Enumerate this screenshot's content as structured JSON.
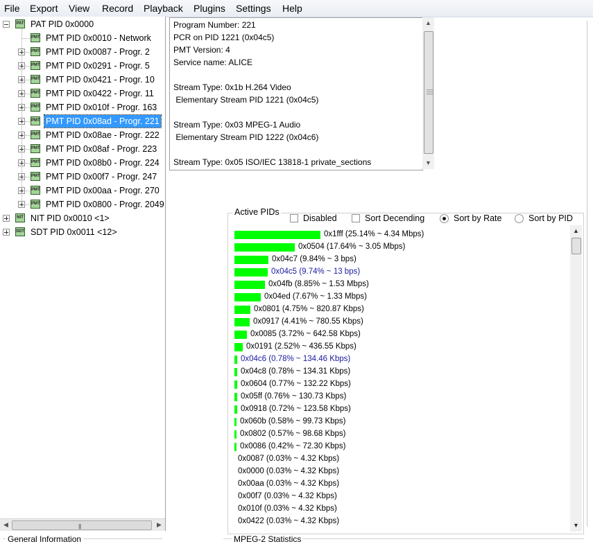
{
  "menu": [
    "File",
    "Export",
    "View",
    "Record",
    "Playback",
    "Plugins",
    "Settings",
    "Help"
  ],
  "tree": {
    "root": {
      "label": "PAT PID 0x0000",
      "icon": "PAT"
    },
    "children": [
      {
        "label": "PMT PID 0x0010 - Network",
        "icon": "PMT",
        "expander": false
      },
      {
        "label": "PMT PID 0x0087 - Progr. 2",
        "icon": "PMT",
        "expander": true
      },
      {
        "label": "PMT PID 0x0291 - Progr. 5",
        "icon": "PMT",
        "expander": true
      },
      {
        "label": "PMT PID 0x0421 - Progr. 10",
        "icon": "PMT",
        "expander": true
      },
      {
        "label": "PMT PID 0x0422 - Progr. 11",
        "icon": "PMT",
        "expander": true
      },
      {
        "label": "PMT PID 0x010f - Progr. 163",
        "icon": "PMT",
        "expander": true
      },
      {
        "label": "PMT PID 0x08ad - Progr. 221",
        "icon": "PMT",
        "expander": true,
        "selected": true
      },
      {
        "label": "PMT PID 0x08ae - Progr. 222",
        "icon": "PMT",
        "expander": true
      },
      {
        "label": "PMT PID 0x08af - Progr. 223",
        "icon": "PMT",
        "expander": true
      },
      {
        "label": "PMT PID 0x08b0 - Progr. 224",
        "icon": "PMT",
        "expander": true
      },
      {
        "label": "PMT PID 0x00f7 - Progr. 247",
        "icon": "PMT",
        "expander": true
      },
      {
        "label": "PMT PID 0x00aa - Progr. 270",
        "icon": "PMT",
        "expander": true
      },
      {
        "label": "PMT PID 0x0800 - Progr. 2049",
        "icon": "PMT",
        "expander": true
      }
    ],
    "others": [
      {
        "label": "NIT PID 0x0010 <1>",
        "icon": "NIT"
      },
      {
        "label": "SDT PID 0x0011 <12>",
        "icon": "SDT"
      }
    ]
  },
  "info": [
    "Program Number: 221",
    "PCR on PID 1221 (0x04c5)",
    "PMT Version: 4",
    "Service name: ALICE",
    "",
    "Stream Type: 0x1b H.264 Video",
    " Elementary Stream PID 1221 (0x04c5)",
    "",
    "Stream Type: 0x03 MPEG-1 Audio",
    " Elementary Stream PID 1222 (0x04c6)",
    "",
    "Stream Type: 0x05 ISO/IEC 13818-1 private_sections"
  ],
  "active_pids": {
    "title": "Active PIDs",
    "options": {
      "disabled": {
        "label": "Disabled",
        "checked": false
      },
      "sort_desc": {
        "label": "Sort Decending",
        "checked": false
      },
      "sort_rate": {
        "label": "Sort by Rate",
        "selected": true
      },
      "sort_pid": {
        "label": "Sort by PID",
        "selected": false
      }
    },
    "rows": [
      {
        "text": "0x1fff (25.14% ~ 4.34 Mbps)",
        "pct": 25.14
      },
      {
        "text": "0x0504 (17.64% ~ 3.05 Mbps)",
        "pct": 17.64
      },
      {
        "text": "0x04c7 (9.84% ~ 3 bps)",
        "pct": 9.84
      },
      {
        "text": "0x04c5 (9.74% ~ 13 bps)",
        "pct": 9.74,
        "highlight": true
      },
      {
        "text": "0x04fb (8.85% ~ 1.53 Mbps)",
        "pct": 8.85
      },
      {
        "text": "0x04ed (7.67% ~ 1.33 Mbps)",
        "pct": 7.67
      },
      {
        "text": "0x0801 (4.75% ~ 820.87 Kbps)",
        "pct": 4.75
      },
      {
        "text": "0x0917 (4.41% ~ 780.55 Kbps)",
        "pct": 4.41
      },
      {
        "text": "0x0085 (3.72% ~ 642.58 Kbps)",
        "pct": 3.72
      },
      {
        "text": "0x0191 (2.52% ~ 436.55 Kbps)",
        "pct": 2.52
      },
      {
        "text": "0x04c6 (0.78% ~ 134.46 Kbps)",
        "pct": 0.78,
        "highlight": true
      },
      {
        "text": "0x04c8 (0.78% ~ 134.31 Kbps)",
        "pct": 0.78
      },
      {
        "text": "0x0604 (0.77% ~ 132.22 Kbps)",
        "pct": 0.77
      },
      {
        "text": "0x05ff (0.76% ~ 130.73 Kbps)",
        "pct": 0.76
      },
      {
        "text": "0x0918 (0.72% ~ 123.58 Kbps)",
        "pct": 0.72
      },
      {
        "text": "0x060b (0.58% ~ 99.73 Kbps)",
        "pct": 0.58
      },
      {
        "text": "0x0802 (0.57% ~ 98.68 Kbps)",
        "pct": 0.57
      },
      {
        "text": "0x0086 (0.42% ~ 72.30 Kbps)",
        "pct": 0.42
      },
      {
        "text": "0x0087 (0.03% ~ 4.32 Kbps)",
        "pct": 0.03
      },
      {
        "text": "0x0000 (0.03% ~ 4.32 Kbps)",
        "pct": 0.03
      },
      {
        "text": "0x00aa (0.03% ~ 4.32 Kbps)",
        "pct": 0.03
      },
      {
        "text": "0x00f7 (0.03% ~ 4.32 Kbps)",
        "pct": 0.03
      },
      {
        "text": "0x010f (0.03% ~ 4.32 Kbps)",
        "pct": 0.03
      },
      {
        "text": "0x0422 (0.03% ~ 4.32 Kbps)",
        "pct": 0.03
      }
    ]
  },
  "bottom": {
    "general": "General Information",
    "mpeg": "MPEG-2 Statistics"
  },
  "colors": {
    "bar": "#00ff00",
    "selection": "#3399ff",
    "highlight_text": "#1a1aa0"
  }
}
